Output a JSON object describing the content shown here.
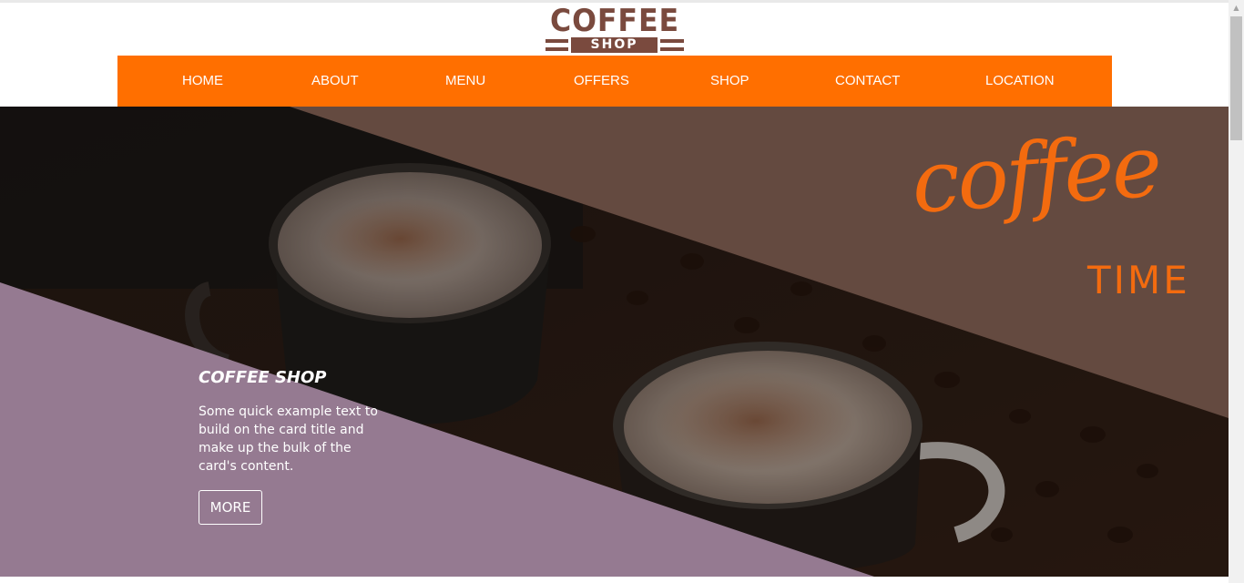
{
  "logo": {
    "word": "COFFEE",
    "sub": "SHOP"
  },
  "nav": {
    "items": [
      {
        "label": "HOME"
      },
      {
        "label": "ABOUT"
      },
      {
        "label": "MENU"
      },
      {
        "label": "OFFERS"
      },
      {
        "label": "SHOP"
      },
      {
        "label": "CONTACT"
      },
      {
        "label": "LOCATION"
      }
    ]
  },
  "hero": {
    "script_word": "coffee",
    "time_word": "TIME",
    "card": {
      "title": "COFFEE SHOP",
      "text": "Some quick example text to build on the card title and make up the bulk of the card's content.",
      "button_label": "MORE"
    }
  },
  "colors": {
    "nav_bg": "#ff6f00",
    "brand_brown": "#7a4a3e",
    "accent_orange": "#f36b0f",
    "overlay_brown": "#644a40",
    "overlay_mauve": "#957a91"
  },
  "icons": {
    "scroll_up": "scroll-up-arrow-icon"
  }
}
